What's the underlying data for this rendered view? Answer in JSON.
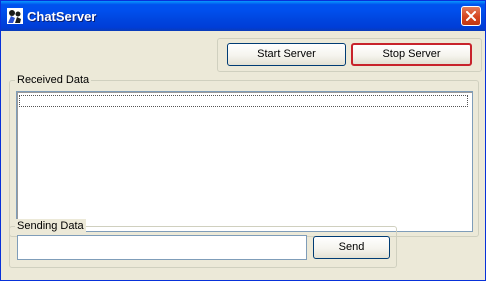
{
  "window": {
    "title": "ChatServer",
    "app_icon": "chat-app-icon",
    "close_icon": "close-icon"
  },
  "toolbar": {
    "start_label": "Start Server",
    "stop_label": "Stop Server"
  },
  "received": {
    "group_label": "Received Data",
    "items": []
  },
  "sending": {
    "group_label": "Sending Data",
    "input_value": "",
    "send_label": "Send"
  },
  "colors": {
    "titlebar": "#0053ee",
    "face": "#ece9d8",
    "focus_border": "#c8232b",
    "close": "#d6451f"
  }
}
